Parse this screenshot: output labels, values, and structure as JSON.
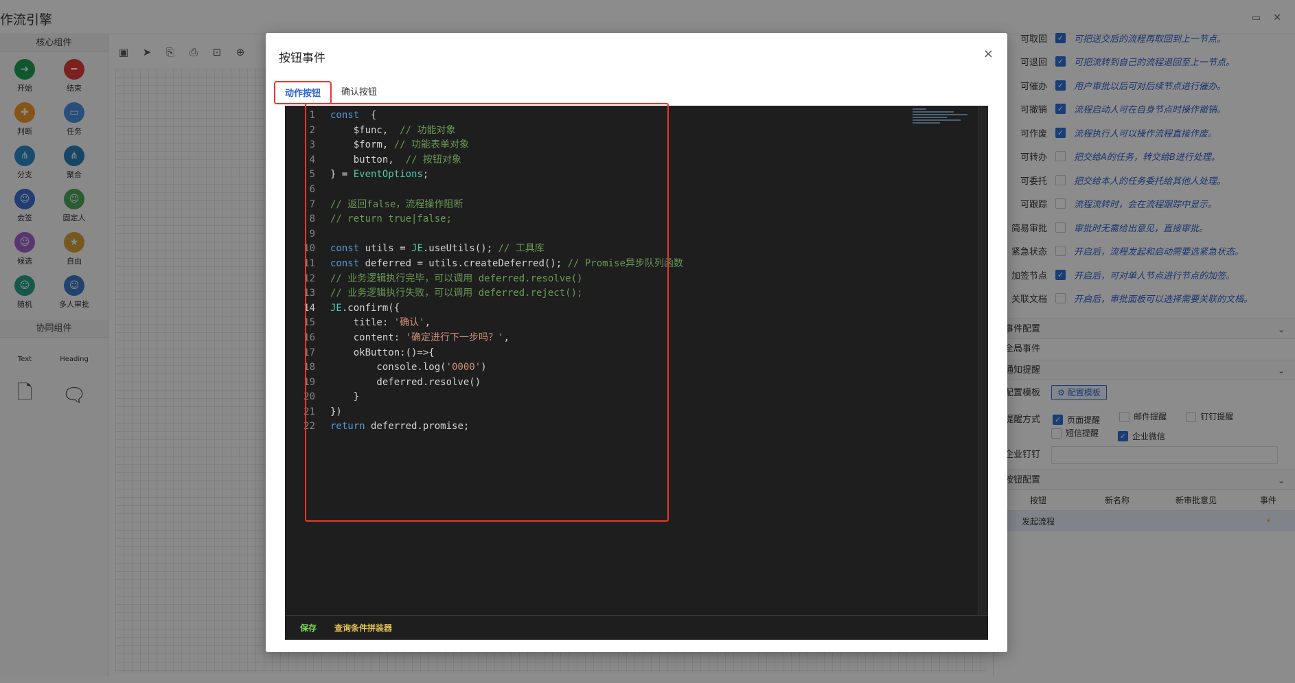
{
  "app": {
    "title": "作流引擎",
    "left_panel": {
      "core_title": "核心组件",
      "core_items": [
        {
          "label": "开始",
          "color": "#1e9e52",
          "icon": "➔"
        },
        {
          "label": "结束",
          "color": "#e23b3b",
          "icon": "━"
        },
        {
          "label": "判断",
          "color": "#f39a2b",
          "icon": "✚"
        },
        {
          "label": "任务",
          "color": "#4a8fe0",
          "icon": "▭"
        },
        {
          "label": "分支",
          "color": "#2a8bc9",
          "icon": "⋔"
        },
        {
          "label": "聚合",
          "color": "#2a7fb8",
          "icon": "⋔"
        },
        {
          "label": "会签",
          "color": "#3d6fd0",
          "icon": "☺"
        },
        {
          "label": "固定人",
          "color": "#4ea65a",
          "icon": "☺"
        },
        {
          "label": "候选",
          "color": "#a064c9",
          "icon": "☺"
        },
        {
          "label": "自由",
          "color": "#d8a23a",
          "icon": "★"
        },
        {
          "label": "随机",
          "color": "#28a38a",
          "icon": "☺"
        },
        {
          "label": "多人审批",
          "color": "#3d78c9",
          "icon": "☺"
        }
      ],
      "collab_title": "协同组件",
      "collab_items": [
        {
          "label": "Text"
        },
        {
          "label": "Heading"
        },
        {
          "label": ""
        },
        {
          "label": ""
        }
      ]
    },
    "right_panel": {
      "options": [
        {
          "label": "可取回",
          "checked": true,
          "desc": "可把送交后的流程再取回到上一节点。"
        },
        {
          "label": "可退回",
          "checked": true,
          "desc": "可把流转到自己的流程退回至上一节点。"
        },
        {
          "label": "可催办",
          "checked": true,
          "desc": "用户审批以后可对后续节点进行催办。"
        },
        {
          "label": "可撤销",
          "checked": true,
          "desc": "流程启动人可在自身节点时操作撤销。"
        },
        {
          "label": "可作废",
          "checked": true,
          "desc": "流程执行人可以操作流程直接作废。"
        },
        {
          "label": "可转办",
          "checked": false,
          "desc": "把交给A的任务，转交给B进行处理。"
        },
        {
          "label": "可委托",
          "checked": false,
          "desc": "把交给本人的任务委托给其他人处理。"
        },
        {
          "label": "可跟踪",
          "checked": false,
          "desc": "流程流转时，会在流程跟踪中显示。"
        },
        {
          "label": "简易审批",
          "checked": false,
          "desc": "审批时无需给出意见，直接审批。"
        },
        {
          "label": "紧急状态",
          "checked": false,
          "desc": "开启后，流程发起和启动需要选紧急状态。"
        },
        {
          "label": "加签节点",
          "checked": true,
          "desc": "开启后，可对单人节点进行节点的加签。"
        },
        {
          "label": "关联文档",
          "checked": false,
          "desc": "开启后，审批面板可以选择需要关联的文档。"
        }
      ],
      "event_section": "事件配置",
      "global_event": "全局事件",
      "notify_section": "通知提醒",
      "template_label": "配置模板",
      "template_button": "配置模板",
      "remind_label": "提醒方式",
      "remind_options": [
        {
          "label": "页面提醒",
          "checked": true
        },
        {
          "label": "邮件提醒",
          "checked": false
        },
        {
          "label": "钉钉提醒",
          "checked": false
        },
        {
          "label": "短信提醒",
          "checked": false
        },
        {
          "label": "企业微信",
          "checked": true
        }
      ],
      "dingtalk_label": "企业钉钉",
      "button_section": "按钮配置",
      "table_headers": [
        "按钮",
        "新名称",
        "新审批意见",
        "事件"
      ],
      "table_rows": [
        {
          "button": "发起流程",
          "new_name": "",
          "new_opinion": "",
          "event": "⚡"
        }
      ]
    }
  },
  "modal": {
    "title": "按钮事件",
    "close": "×",
    "tabs": [
      {
        "label": "动作按钮",
        "active": true
      },
      {
        "label": "确认按钮",
        "active": false
      }
    ],
    "current_line": 14,
    "code_lines": [
      [
        [
          "kw",
          "const"
        ],
        [
          "",
          "  {"
        ]
      ],
      [
        [
          "",
          "    $func,  "
        ],
        [
          "cm",
          "// 功能对象"
        ]
      ],
      [
        [
          "",
          "    $form, "
        ],
        [
          "cm",
          "// 功能表单对象"
        ]
      ],
      [
        [
          "",
          "    button,  "
        ],
        [
          "cm",
          "// 按钮对象"
        ]
      ],
      [
        [
          "",
          "} = "
        ],
        [
          "ty",
          "EventOptions"
        ],
        [
          "",
          ";"
        ]
      ],
      [
        [
          "",
          ""
        ]
      ],
      [
        [
          "cm",
          "// 返回false，流程操作阻断"
        ]
      ],
      [
        [
          "cm",
          "// return true|false;"
        ]
      ],
      [
        [
          "",
          ""
        ]
      ],
      [
        [
          "kw",
          "const"
        ],
        [
          "",
          " utils = "
        ],
        [
          "ty",
          "JE"
        ],
        [
          "",
          ".useUtils(); "
        ],
        [
          "cm",
          "// 工具库"
        ]
      ],
      [
        [
          "kw",
          "const"
        ],
        [
          "",
          " deferred = utils.createDeferred(); "
        ],
        [
          "cm",
          "// Promise异步队列函数"
        ]
      ],
      [
        [
          "cm",
          "// 业务逻辑执行完毕，可以调用 deferred.resolve()"
        ]
      ],
      [
        [
          "cm",
          "// 业务逻辑执行失败，可以调用 deferred.reject();"
        ]
      ],
      [
        [
          "ty",
          "JE"
        ],
        [
          "",
          ".confirm({"
        ]
      ],
      [
        [
          "",
          "    title: "
        ],
        [
          "st",
          "'确认'"
        ],
        [
          "",
          ","
        ]
      ],
      [
        [
          "",
          "    content: "
        ],
        [
          "st",
          "'确定进行下一步吗？'"
        ],
        [
          "",
          ","
        ]
      ],
      [
        [
          "",
          "    okButton:()=>{"
        ]
      ],
      [
        [
          "",
          "        console.log("
        ],
        [
          "st",
          "'0000'"
        ],
        [
          "",
          ")"
        ]
      ],
      [
        [
          "",
          "        deferred.resolve()"
        ]
      ],
      [
        [
          "",
          "    }"
        ]
      ],
      [
        [
          "",
          "})"
        ]
      ],
      [
        [
          "kw",
          "return"
        ],
        [
          "",
          " deferred.promise;"
        ]
      ]
    ],
    "footer_buttons": {
      "save": "保存",
      "builder": "查询条件拼装器"
    }
  }
}
